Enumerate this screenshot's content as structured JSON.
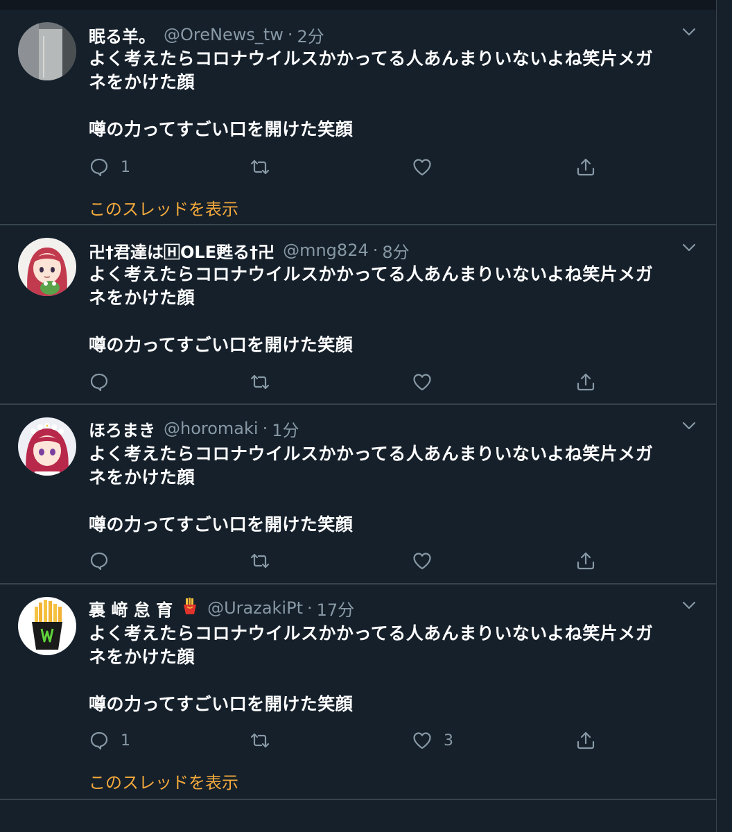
{
  "colors": {
    "background": "#15202b",
    "border": "#38444d",
    "secondary_text": "#8899a6",
    "thread_link": "#f4a93b"
  },
  "tweets": [
    {
      "name": "眠る羊。",
      "handle": "@OreNews_tw",
      "time": "2分",
      "body_line1": "よく考えたらコロナウイルスかかってる人あんまりいないよね笑片メガ",
      "body_line2": "ネをかけた顔",
      "body_line3": "噂の力ってすごい口を開けた笑顔",
      "reply_count": "1",
      "retweet_count": "",
      "like_count": "",
      "thread_link": "このスレッドを表示",
      "avatar": "photo-avatar"
    },
    {
      "name": "卍†君達は🄷OLE甦る†卍",
      "handle": "@mng824",
      "time": "8分",
      "body_line1": "よく考えたらコロナウイルスかかってる人あんまりいないよね笑片メガ",
      "body_line2": "ネをかけた顔",
      "body_line3": "噂の力ってすごい口を開けた笑顔",
      "reply_count": "",
      "retweet_count": "",
      "like_count": "",
      "avatar": "anime-avatar-red-hair-frog"
    },
    {
      "name": "ほろまき",
      "handle": "@horomaki",
      "time": "1分",
      "body_line1": "よく考えたらコロナウイルスかかってる人あんまりいないよね笑片メガ",
      "body_line2": "ネをかけた顔",
      "body_line3": "噂の力ってすごい口を開けた笑顔",
      "reply_count": "",
      "retweet_count": "",
      "like_count": "",
      "avatar": "anime-avatar-flower-crown"
    },
    {
      "name": "裏 﨑 怠 育",
      "handle": "@UrazakiPt",
      "time": "17分",
      "body_line1": "よく考えたらコロナウイルスかかってる人あんまりいないよね笑片メガ",
      "body_line2": "ネをかけた顔",
      "body_line3": "噂の力ってすごい口を開けた笑顔",
      "reply_count": "1",
      "retweet_count": "",
      "like_count": "3",
      "thread_link": "このスレッドを表示",
      "name_emoji": "french-fries-emoji",
      "avatar": "fries-avatar"
    }
  ]
}
